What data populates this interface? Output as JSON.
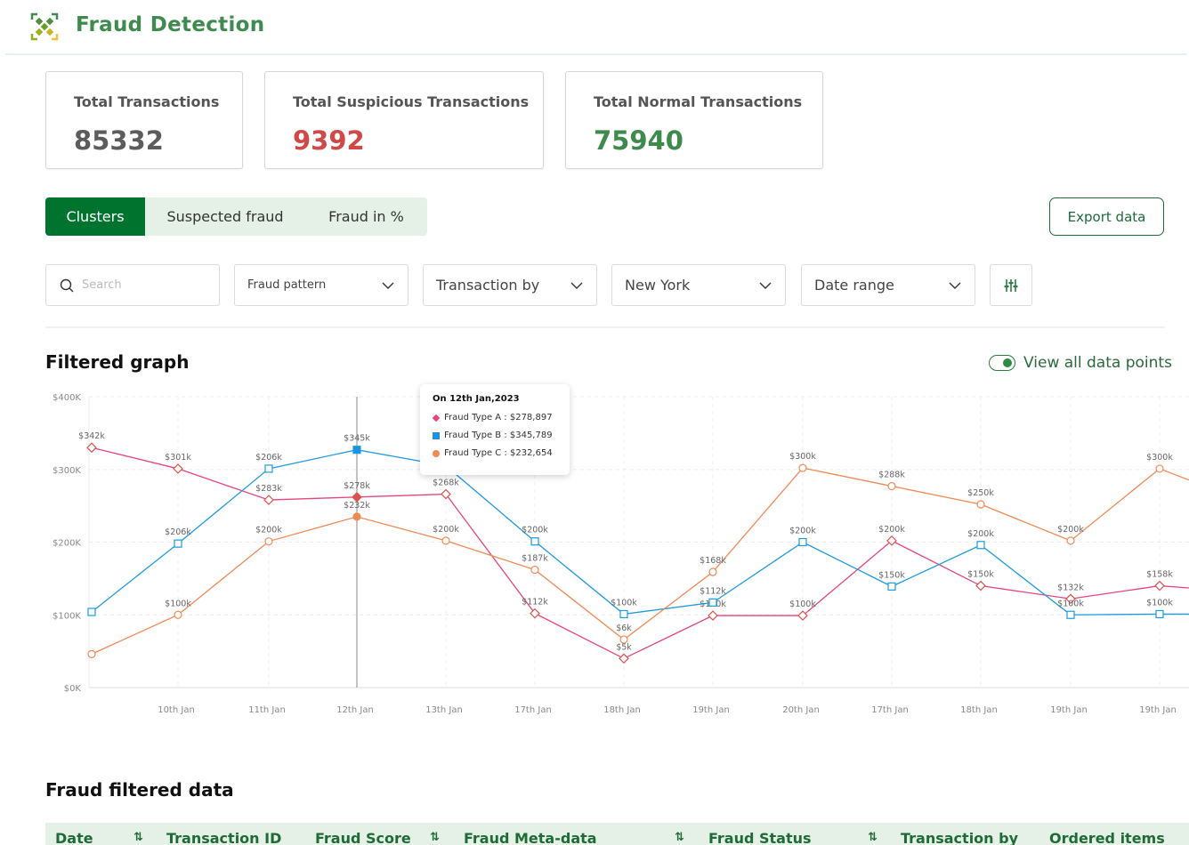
{
  "app": {
    "title": "Fraud Detection",
    "logo_icon": "fraud-detection-logo-icon"
  },
  "stats": [
    {
      "label": "Total Transactions",
      "value": "85332",
      "color": "#5c5c5c"
    },
    {
      "label": "Total Suspicious Transactions",
      "value": "9392",
      "color": "#d04848"
    },
    {
      "label": "Total Normal Transactions",
      "value": "75940",
      "color": "#3d8a4c"
    }
  ],
  "view_tabs": [
    {
      "label": "Clusters",
      "active": true
    },
    {
      "label": "Suspected fraud",
      "active": false
    },
    {
      "label": "Fraud in %",
      "active": false
    }
  ],
  "export_label": "Export data",
  "filters": {
    "search_placeholder": "Search",
    "search_value": "",
    "fraud_pattern": "Fraud pattern",
    "transaction_by": "Transaction by",
    "location": "New York",
    "date_range": "Date range",
    "settings_icon": "sliders-icon"
  },
  "graph": {
    "title": "Filtered graph",
    "toggle_label": "View all data points",
    "toggle_on": true
  },
  "tooltip": {
    "title": "On 12th Jan,2023",
    "rows": [
      {
        "label": "Fraud Type A :  $278,897",
        "color": "#e8457a",
        "shape": "diamond"
      },
      {
        "label": "Fraud Type B : $345,789",
        "color": "#1e90e0",
        "shape": "square"
      },
      {
        "label": "Fraud Type C : $232,654",
        "color": "#f08a55",
        "shape": "circle"
      }
    ]
  },
  "chart_data": {
    "type": "line",
    "title": "Filtered graph",
    "xlabel": "",
    "ylabel": "",
    "ylim": [
      0,
      400
    ],
    "y_unit": "K USD",
    "y_ticks": [
      "$0K",
      "$100K",
      "$200K",
      "$300K",
      "$400K"
    ],
    "categories": [
      "",
      "10th Jan",
      "11th Jan",
      "12th Jan",
      "13th Jan",
      "17th Jan",
      "18th Jan",
      "19th Jan",
      "20th Jan",
      "17th Jan",
      "18th Jan",
      "19th Jan",
      "19th Jan",
      ""
    ],
    "grid": true,
    "legend": "tooltip",
    "highlighted_index": 3,
    "series": [
      {
        "name": "Fraud Type A",
        "color": "#e8457a",
        "marker": "diamond",
        "values": [
          330,
          301,
          258,
          262,
          266,
          102,
          40,
          99,
          99,
          202,
          140,
          122,
          140,
          132
        ],
        "labels": [
          "$342k",
          "$301k",
          "$283k",
          "$278k",
          "$268k",
          "$112k",
          "$5k",
          "$100k",
          "$100k",
          "$200k",
          "$150k",
          "$132k",
          "$158k",
          ""
        ]
      },
      {
        "name": "Fraud Type B",
        "color": "#1e9be0",
        "marker": "square",
        "values": [
          104,
          198,
          301,
          327,
          305,
          201,
          101,
          117,
          200,
          139,
          196,
          100,
          101,
          101
        ],
        "labels": [
          "",
          "$206k",
          "$206k",
          "$345k",
          "",
          "$200k",
          "$100k",
          "$112k",
          "$200k",
          "$150k",
          "$200k",
          "$100k",
          "$100k",
          ""
        ]
      },
      {
        "name": "Fraud Type C",
        "color": "#f08a55",
        "marker": "circle",
        "values": [
          46,
          100,
          201,
          235,
          202,
          162,
          66,
          159,
          302,
          277,
          252,
          202,
          301,
          260
        ],
        "labels": [
          "",
          "$100k",
          "$200k",
          "$232k",
          "$200k",
          "$187k",
          "$6k",
          "$168k",
          "$300k",
          "$288k",
          "$250k",
          "$200k",
          "$300k",
          ""
        ]
      }
    ]
  },
  "table": {
    "title": "Fraud filtered data",
    "columns": [
      {
        "label": "Date",
        "sortable": true
      },
      {
        "label": "Transaction ID",
        "sortable": false
      },
      {
        "label": "Fraud Score",
        "sortable": true
      },
      {
        "label": "Fraud Meta-data",
        "sortable": true
      },
      {
        "label": "Fraud Status",
        "sortable": true
      },
      {
        "label": "Transaction by",
        "sortable": false
      },
      {
        "label": "Ordered items",
        "sortable": false
      }
    ],
    "sort_icon": "⇅"
  }
}
